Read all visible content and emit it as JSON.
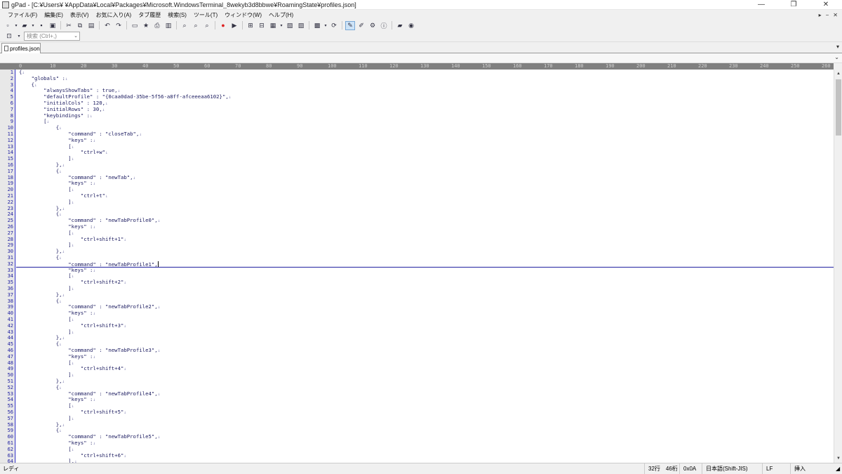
{
  "window": {
    "title": "gPad - [C:¥Users¥               ¥AppData¥Local¥Packages¥Microsoft.WindowsTerminal_8wekyb3d8bbwe¥RoamingState¥profiles.json]",
    "minimize": "—",
    "restore": "❐",
    "close": "✕"
  },
  "menu": {
    "items": [
      "ファイル(F)",
      "編集(E)",
      "表示(V)",
      "お気に入り(A)",
      "タブ履歴",
      "検索(S)",
      "ツール(T)",
      "ウィンドウ(W)",
      "ヘルプ(H)"
    ],
    "right": [
      "▸",
      "−",
      "✕"
    ]
  },
  "search": {
    "placeholder": "検索 (Ctrl+,)"
  },
  "tab": {
    "label": "profiles.json"
  },
  "ruler": [
    "0",
    "10",
    "20",
    "30",
    "40",
    "50",
    "60",
    "70",
    "80",
    "90",
    "100",
    "110",
    "120",
    "130",
    "140",
    "150",
    "160",
    "170",
    "180",
    "190",
    "200",
    "210",
    "220",
    "230",
    "240",
    "250",
    "260"
  ],
  "editor": {
    "cursor_line": 32,
    "lines": [
      "{",
      "    \"globals\" :",
      "    {",
      "        \"alwaysShowTabs\" : true,",
      "        \"defaultProfile\" : \"{0caa0dad-35be-5f56-a8ff-afceeeaa6102}\",",
      "        \"initialCols\" : 120,",
      "        \"initialRows\" : 30,",
      "        \"keybindings\" :",
      "        [",
      "            {",
      "                \"command\" : \"closeTab\",",
      "                \"keys\" :",
      "                [",
      "                    \"ctrl+w\"",
      "                ]",
      "            },",
      "            {",
      "                \"command\" : \"newTab\",",
      "                \"keys\" :",
      "                [",
      "                    \"ctrl+t\"",
      "                ]",
      "            },",
      "            {",
      "                \"command\" : \"newTabProfile0\",",
      "                \"keys\" :",
      "                [",
      "                    \"ctrl+shift+1\"",
      "                ]",
      "            },",
      "            {",
      "                \"command\" : \"newTabProfile1\",",
      "                \"keys\" :",
      "                [",
      "                    \"ctrl+shift+2\"",
      "                ]",
      "            },",
      "            {",
      "                \"command\" : \"newTabProfile2\",",
      "                \"keys\" :",
      "                [",
      "                    \"ctrl+shift+3\"",
      "                ]",
      "            },",
      "            {",
      "                \"command\" : \"newTabProfile3\",",
      "                \"keys\" :",
      "                [",
      "                    \"ctrl+shift+4\"",
      "                ]",
      "            },",
      "            {",
      "                \"command\" : \"newTabProfile4\",",
      "                \"keys\" :",
      "                [",
      "                    \"ctrl+shift+5\"",
      "                ]",
      "            },",
      "            {",
      "                \"command\" : \"newTabProfile5\",",
      "                \"keys\" :",
      "                [",
      "                    \"ctrl+shift+6\"",
      "                ],"
    ]
  },
  "status": {
    "ready": "レディ",
    "position": "32行　46桁",
    "char_code": "0x0A",
    "encoding": "日本語(Shift-JIS)",
    "line_ending": "LF",
    "mode": "挿入"
  }
}
